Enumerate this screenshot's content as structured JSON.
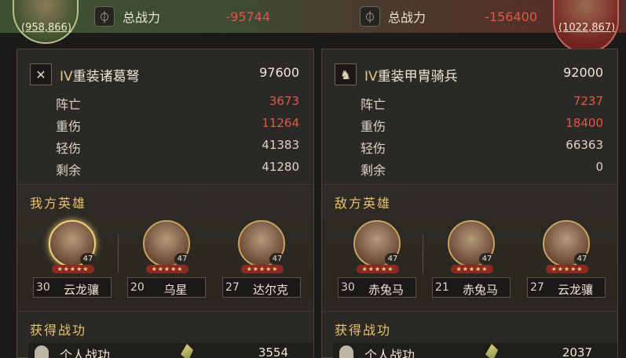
{
  "top": {
    "left": {
      "power_label": "总战力",
      "power_value": "-95744",
      "emblem_value": "(958,866)"
    },
    "right": {
      "power_label": "总战力",
      "power_value": "-156400",
      "emblem_value": "(1022,867)"
    }
  },
  "left_panel": {
    "unit": {
      "roman": "IV",
      "name": "重装诸葛弩",
      "total": "97600",
      "icon": "crossbow-icon"
    },
    "stats": [
      {
        "label": "阵亡",
        "value": "3673",
        "color": "#e0564c"
      },
      {
        "label": "重伤",
        "value": "11264",
        "color": "#e0564c"
      },
      {
        "label": "轻伤",
        "value": "41383",
        "color": "#dcd5c4"
      },
      {
        "label": "剩余",
        "value": "41280",
        "color": "#dcd5c4"
      }
    ],
    "heroes_title": "我方英雄",
    "heroes": [
      {
        "level": "47",
        "stars": "★★★★★",
        "num": "30",
        "name": "云龙骧",
        "highlight": true
      },
      {
        "level": "47",
        "stars": "★★★★★",
        "num": "20",
        "name": "乌星",
        "highlight": false
      },
      {
        "level": "47",
        "stars": "★★★★★",
        "num": "27",
        "name": "达尔克",
        "highlight": false
      }
    ],
    "merit_title": "获得战功",
    "merit": {
      "label": "个人战功",
      "value": "3554"
    }
  },
  "right_panel": {
    "unit": {
      "roman": "IV",
      "name": "重装甲胄骑兵",
      "total": "92000",
      "icon": "horse-icon"
    },
    "stats": [
      {
        "label": "阵亡",
        "value": "7237",
        "color": "#e0564c"
      },
      {
        "label": "重伤",
        "value": "18400",
        "color": "#e0564c"
      },
      {
        "label": "轻伤",
        "value": "66363",
        "color": "#dcd5c4"
      },
      {
        "label": "剩余",
        "value": "0",
        "color": "#dcd5c4"
      }
    ],
    "heroes_title": "敌方英雄",
    "heroes": [
      {
        "level": "47",
        "stars": "★★★★★",
        "num": "30",
        "name": "赤兔马",
        "highlight": false
      },
      {
        "level": "47",
        "stars": "★★★★★",
        "num": "21",
        "name": "赤兔马",
        "highlight": false
      },
      {
        "level": "47",
        "stars": "★★★★★",
        "num": "27",
        "name": "云龙骧",
        "highlight": false
      }
    ],
    "merit_title": "获得战功",
    "merit": {
      "label": "个人战功",
      "value": "2037"
    }
  }
}
